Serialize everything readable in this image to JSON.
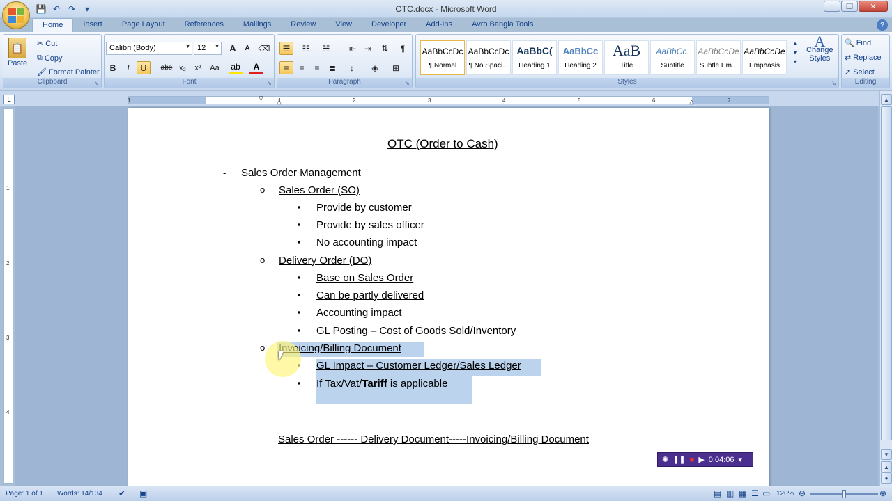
{
  "window": {
    "title": "OTC.docx - Microsoft Word",
    "minimize": "─",
    "restore": "❐",
    "close": "✕"
  },
  "tabs": [
    "Home",
    "Insert",
    "Page Layout",
    "References",
    "Mailings",
    "Review",
    "View",
    "Developer",
    "Add-Ins",
    "Avro Bangla Tools"
  ],
  "ribbon": {
    "clipboard": {
      "label": "Clipboard",
      "paste": "Paste",
      "cut": "Cut",
      "copy": "Copy",
      "format_painter": "Format Painter"
    },
    "font": {
      "label": "Font",
      "font_name": "Calibri (Body)",
      "font_size": "12",
      "bold": "B",
      "italic": "I",
      "underline": "U",
      "strike": "abe",
      "subscript": "x₂",
      "superscript": "x²",
      "change_case": "Aa",
      "grow": "A",
      "shrink": "A"
    },
    "paragraph": {
      "label": "Paragraph",
      "show_marks": "¶"
    },
    "styles": {
      "label": "Styles",
      "items": [
        {
          "sample": "AaBbCcDc",
          "name": "¶ Normal"
        },
        {
          "sample": "AaBbCcDc",
          "name": "¶ No Spaci..."
        },
        {
          "sample": "AaBbC(",
          "name": "Heading 1"
        },
        {
          "sample": "AaBbCc",
          "name": "Heading 2"
        },
        {
          "sample": "AaB",
          "name": "Title"
        },
        {
          "sample": "AaBbCc.",
          "name": "Subtitle"
        },
        {
          "sample": "AaBbCcDe",
          "name": "Subtle Em..."
        },
        {
          "sample": "AaBbCcDe",
          "name": "Emphasis"
        }
      ],
      "change_styles_1": "Change",
      "change_styles_2": "Styles"
    },
    "editing": {
      "label": "Editing",
      "find": "Find",
      "replace": "Replace",
      "select": "Select"
    }
  },
  "ruler": {
    "h_numbers": [
      "1",
      "1",
      "2",
      "3",
      "4",
      "5",
      "6",
      "7"
    ],
    "v_numbers": [
      "1",
      "2",
      "3",
      "4"
    ]
  },
  "document": {
    "title": "OTC (Order to Cash)",
    "dash_marker": "-",
    "circle_marker": "o",
    "square_marker": "▪",
    "section": "Sales Order Management",
    "so": {
      "heading": "Sales Order (SO)",
      "items": [
        "Provide by customer",
        "Provide by sales officer",
        "No accounting impact"
      ]
    },
    "do": {
      "heading": "Delivery Order (DO)",
      "items": [
        "Base on Sales Order",
        "Can be partly delivered",
        "Accounting impact",
        "GL Posting – Cost of Goods Sold/Inventory"
      ]
    },
    "inv": {
      "heading": "Invoicing/Billing  Document",
      "item1": "GL Impact – Customer  Ledger/Sales  Ledger",
      "item2_pre": "If Tax/Vat/",
      "item2_bold": "Tariff",
      "item2_post": "  is applicable"
    },
    "flow": "Sales Order ------ Delivery Document-----Invoicing/Billing  Document"
  },
  "status": {
    "page": "Page: 1 of 1",
    "words": "Words: 14/134",
    "zoom": "120%"
  },
  "recorder": {
    "time": "0:04:06"
  }
}
